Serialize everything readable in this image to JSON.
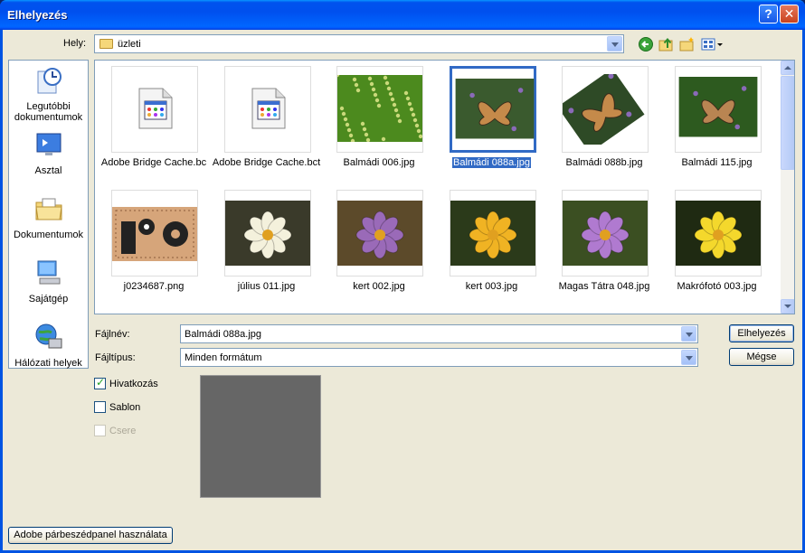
{
  "window": {
    "title": "Elhelyezés"
  },
  "location": {
    "label": "Hely:",
    "value": "üzleti"
  },
  "places": [
    {
      "label": "Legutóbbi dokumentumok",
      "icon": "recent-documents-icon"
    },
    {
      "label": "Asztal",
      "icon": "desktop-icon"
    },
    {
      "label": "Dokumentumok",
      "icon": "documents-folder-icon"
    },
    {
      "label": "Sajátgép",
      "icon": "my-computer-icon"
    },
    {
      "label": "Hálózati helyek",
      "icon": "network-places-icon"
    }
  ],
  "files": [
    {
      "name": "Adobe Bridge Cache.bc",
      "kind": "doc-icon"
    },
    {
      "name": "Adobe Bridge Cache.bct",
      "kind": "doc-icon"
    },
    {
      "name": "Balmádi 006.jpg",
      "kind": "grass",
      "palette": [
        "#4c8a1e",
        "#c9d97a"
      ]
    },
    {
      "name": "Balmádi 088a.jpg",
      "kind": "butterfly",
      "palette": [
        "#3a5a2e",
        "#c58a4a"
      ],
      "selected": true
    },
    {
      "name": "Balmádi 088b.jpg",
      "kind": "butterfly-rot",
      "palette": [
        "#2e4a26",
        "#c58a4a"
      ]
    },
    {
      "name": "Balmádi 115.jpg",
      "kind": "butterfly",
      "palette": [
        "#2d5a1f",
        "#b98552"
      ]
    },
    {
      "name": "j0234687.png",
      "kind": "gears",
      "palette": [
        "#d6a57a",
        "#222"
      ]
    },
    {
      "name": "július 011.jpg",
      "kind": "flower",
      "palette": [
        "#3a3a2a",
        "#f4f1dc"
      ]
    },
    {
      "name": "kert 002.jpg",
      "kind": "flower",
      "palette": [
        "#5c4a2a",
        "#9a6ab8"
      ]
    },
    {
      "name": "kert 003.jpg",
      "kind": "flower",
      "palette": [
        "#2b3a1a",
        "#f0b323"
      ]
    },
    {
      "name": "Magas Tátra 048.jpg",
      "kind": "flower",
      "palette": [
        "#3b4f22",
        "#b07ad0"
      ]
    },
    {
      "name": "Makrófotó 003.jpg",
      "kind": "flower",
      "palette": [
        "#1f2a12",
        "#f4d82c"
      ]
    }
  ],
  "filename": {
    "label": "Fájlnév:",
    "value": "Balmádi 088a.jpg"
  },
  "filetype": {
    "label": "Fájltípus:",
    "value": "Minden formátum"
  },
  "buttons": {
    "place": "Elhelyezés",
    "cancel": "Mégse",
    "adobe_dialog": "Adobe párbeszédpanel használata"
  },
  "options": [
    {
      "label": "Hivatkozás",
      "checked": true,
      "enabled": true
    },
    {
      "label": "Sablon",
      "checked": false,
      "enabled": true
    },
    {
      "label": "Csere",
      "checked": false,
      "enabled": false
    }
  ]
}
